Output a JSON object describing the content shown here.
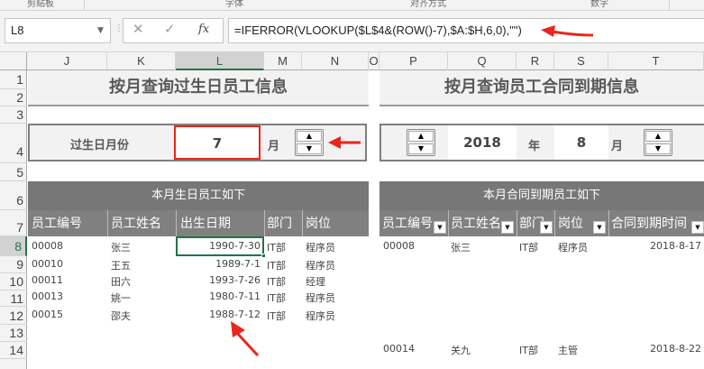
{
  "ribbon": {
    "groups": [
      "剪贴板",
      "字体",
      "对齐方式",
      "数字"
    ]
  },
  "formula_bar": {
    "name_box": "L8",
    "cancel_symbol": "✕",
    "enter_symbol": "✓",
    "fx_symbol": "fx",
    "formula": "=IFERROR(VLOOKUP($L$4&(ROW()-7),$A:$H,6,0),\"\")"
  },
  "columns": [
    "J",
    "K",
    "L",
    "M",
    "N",
    "O",
    "P",
    "Q",
    "R",
    "S",
    "T"
  ],
  "rows": [
    "1",
    "2",
    "3",
    "4",
    "5",
    "6",
    "7",
    "8",
    "9",
    "10",
    "11",
    "12",
    "13",
    "14"
  ],
  "selected_cell": {
    "column": "L",
    "row": "8"
  },
  "birthday": {
    "title": "按月查询过生日员工信息",
    "control_label": "过生日月份",
    "month_value": "7",
    "month_unit": "月",
    "banner": "本月生日员工如下",
    "headers": [
      "员工编号",
      "员工姓名",
      "出生日期",
      "部门",
      "岗位"
    ],
    "rows": [
      [
        "00008",
        "张三",
        "1990-7-30",
        "IT部",
        "程序员"
      ],
      [
        "00010",
        "王五",
        "1989-7-1",
        "IT部",
        "程序员"
      ],
      [
        "00011",
        "田六",
        "1993-7-26",
        "IT部",
        "经理"
      ],
      [
        "00013",
        "姚一",
        "1980-7-11",
        "IT部",
        "程序员"
      ],
      [
        "00015",
        "邵夫",
        "1988-7-12",
        "IT部",
        "程序员"
      ]
    ]
  },
  "contract": {
    "title": "按月查询员工合同到期信息",
    "year_value": "2018",
    "year_unit": "年",
    "month_value": "8",
    "month_unit": "月",
    "banner": "本月合同到期员工如下",
    "headers": [
      "员工编号",
      "员工姓名",
      "部门",
      "岗位",
      "合同到期时间"
    ],
    "rows": [
      [
        "00008",
        "张三",
        "IT部",
        "程序员",
        "2018-8-17"
      ],
      [
        "00014",
        "关九",
        "IT部",
        "主管",
        "2018-8-22"
      ]
    ]
  },
  "colors": {
    "annotation_red": "#e8261c",
    "excel_green": "#217346",
    "header_gray": "#808080"
  },
  "icons": [
    "spinner-up-icon",
    "spinner-down-icon",
    "filter-dropdown-icon",
    "red-arrow-annotation"
  ]
}
